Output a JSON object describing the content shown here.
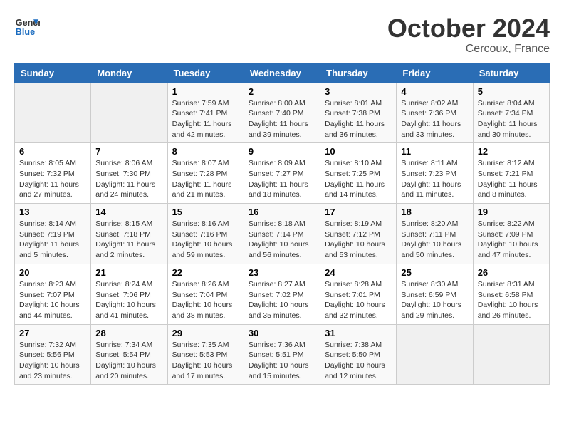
{
  "header": {
    "logo_line1": "General",
    "logo_line2": "Blue",
    "month": "October 2024",
    "location": "Cercoux, France"
  },
  "days_of_week": [
    "Sunday",
    "Monday",
    "Tuesday",
    "Wednesday",
    "Thursday",
    "Friday",
    "Saturday"
  ],
  "weeks": [
    [
      {
        "day": "",
        "empty": true
      },
      {
        "day": "",
        "empty": true
      },
      {
        "day": "1",
        "sunrise": "Sunrise: 7:59 AM",
        "sunset": "Sunset: 7:41 PM",
        "daylight": "Daylight: 11 hours and 42 minutes."
      },
      {
        "day": "2",
        "sunrise": "Sunrise: 8:00 AM",
        "sunset": "Sunset: 7:40 PM",
        "daylight": "Daylight: 11 hours and 39 minutes."
      },
      {
        "day": "3",
        "sunrise": "Sunrise: 8:01 AM",
        "sunset": "Sunset: 7:38 PM",
        "daylight": "Daylight: 11 hours and 36 minutes."
      },
      {
        "day": "4",
        "sunrise": "Sunrise: 8:02 AM",
        "sunset": "Sunset: 7:36 PM",
        "daylight": "Daylight: 11 hours and 33 minutes."
      },
      {
        "day": "5",
        "sunrise": "Sunrise: 8:04 AM",
        "sunset": "Sunset: 7:34 PM",
        "daylight": "Daylight: 11 hours and 30 minutes."
      }
    ],
    [
      {
        "day": "6",
        "sunrise": "Sunrise: 8:05 AM",
        "sunset": "Sunset: 7:32 PM",
        "daylight": "Daylight: 11 hours and 27 minutes."
      },
      {
        "day": "7",
        "sunrise": "Sunrise: 8:06 AM",
        "sunset": "Sunset: 7:30 PM",
        "daylight": "Daylight: 11 hours and 24 minutes."
      },
      {
        "day": "8",
        "sunrise": "Sunrise: 8:07 AM",
        "sunset": "Sunset: 7:28 PM",
        "daylight": "Daylight: 11 hours and 21 minutes."
      },
      {
        "day": "9",
        "sunrise": "Sunrise: 8:09 AM",
        "sunset": "Sunset: 7:27 PM",
        "daylight": "Daylight: 11 hours and 18 minutes."
      },
      {
        "day": "10",
        "sunrise": "Sunrise: 8:10 AM",
        "sunset": "Sunset: 7:25 PM",
        "daylight": "Daylight: 11 hours and 14 minutes."
      },
      {
        "day": "11",
        "sunrise": "Sunrise: 8:11 AM",
        "sunset": "Sunset: 7:23 PM",
        "daylight": "Daylight: 11 hours and 11 minutes."
      },
      {
        "day": "12",
        "sunrise": "Sunrise: 8:12 AM",
        "sunset": "Sunset: 7:21 PM",
        "daylight": "Daylight: 11 hours and 8 minutes."
      }
    ],
    [
      {
        "day": "13",
        "sunrise": "Sunrise: 8:14 AM",
        "sunset": "Sunset: 7:19 PM",
        "daylight": "Daylight: 11 hours and 5 minutes."
      },
      {
        "day": "14",
        "sunrise": "Sunrise: 8:15 AM",
        "sunset": "Sunset: 7:18 PM",
        "daylight": "Daylight: 11 hours and 2 minutes."
      },
      {
        "day": "15",
        "sunrise": "Sunrise: 8:16 AM",
        "sunset": "Sunset: 7:16 PM",
        "daylight": "Daylight: 10 hours and 59 minutes."
      },
      {
        "day": "16",
        "sunrise": "Sunrise: 8:18 AM",
        "sunset": "Sunset: 7:14 PM",
        "daylight": "Daylight: 10 hours and 56 minutes."
      },
      {
        "day": "17",
        "sunrise": "Sunrise: 8:19 AM",
        "sunset": "Sunset: 7:12 PM",
        "daylight": "Daylight: 10 hours and 53 minutes."
      },
      {
        "day": "18",
        "sunrise": "Sunrise: 8:20 AM",
        "sunset": "Sunset: 7:11 PM",
        "daylight": "Daylight: 10 hours and 50 minutes."
      },
      {
        "day": "19",
        "sunrise": "Sunrise: 8:22 AM",
        "sunset": "Sunset: 7:09 PM",
        "daylight": "Daylight: 10 hours and 47 minutes."
      }
    ],
    [
      {
        "day": "20",
        "sunrise": "Sunrise: 8:23 AM",
        "sunset": "Sunset: 7:07 PM",
        "daylight": "Daylight: 10 hours and 44 minutes."
      },
      {
        "day": "21",
        "sunrise": "Sunrise: 8:24 AM",
        "sunset": "Sunset: 7:06 PM",
        "daylight": "Daylight: 10 hours and 41 minutes."
      },
      {
        "day": "22",
        "sunrise": "Sunrise: 8:26 AM",
        "sunset": "Sunset: 7:04 PM",
        "daylight": "Daylight: 10 hours and 38 minutes."
      },
      {
        "day": "23",
        "sunrise": "Sunrise: 8:27 AM",
        "sunset": "Sunset: 7:02 PM",
        "daylight": "Daylight: 10 hours and 35 minutes."
      },
      {
        "day": "24",
        "sunrise": "Sunrise: 8:28 AM",
        "sunset": "Sunset: 7:01 PM",
        "daylight": "Daylight: 10 hours and 32 minutes."
      },
      {
        "day": "25",
        "sunrise": "Sunrise: 8:30 AM",
        "sunset": "Sunset: 6:59 PM",
        "daylight": "Daylight: 10 hours and 29 minutes."
      },
      {
        "day": "26",
        "sunrise": "Sunrise: 8:31 AM",
        "sunset": "Sunset: 6:58 PM",
        "daylight": "Daylight: 10 hours and 26 minutes."
      }
    ],
    [
      {
        "day": "27",
        "sunrise": "Sunrise: 7:32 AM",
        "sunset": "Sunset: 5:56 PM",
        "daylight": "Daylight: 10 hours and 23 minutes."
      },
      {
        "day": "28",
        "sunrise": "Sunrise: 7:34 AM",
        "sunset": "Sunset: 5:54 PM",
        "daylight": "Daylight: 10 hours and 20 minutes."
      },
      {
        "day": "29",
        "sunrise": "Sunrise: 7:35 AM",
        "sunset": "Sunset: 5:53 PM",
        "daylight": "Daylight: 10 hours and 17 minutes."
      },
      {
        "day": "30",
        "sunrise": "Sunrise: 7:36 AM",
        "sunset": "Sunset: 5:51 PM",
        "daylight": "Daylight: 10 hours and 15 minutes."
      },
      {
        "day": "31",
        "sunrise": "Sunrise: 7:38 AM",
        "sunset": "Sunset: 5:50 PM",
        "daylight": "Daylight: 10 hours and 12 minutes."
      },
      {
        "day": "",
        "empty": true
      },
      {
        "day": "",
        "empty": true
      }
    ]
  ]
}
